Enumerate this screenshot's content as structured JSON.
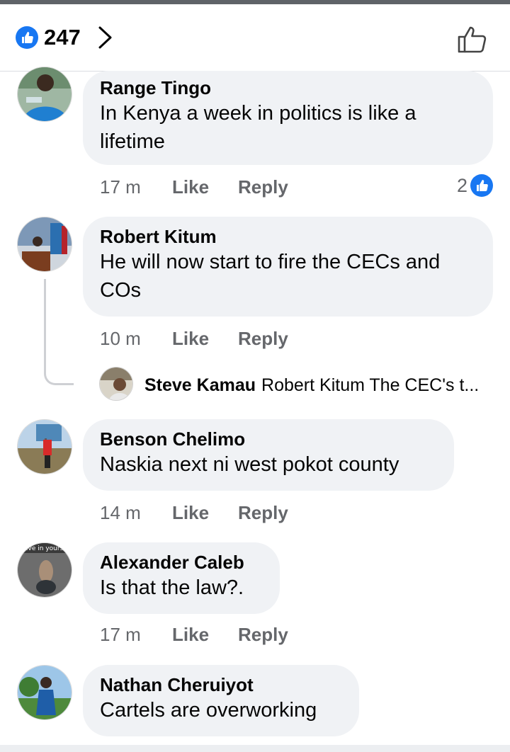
{
  "header": {
    "reaction_icon": "like-badge-icon",
    "reaction_count": "247",
    "chevron_icon": "chevron-right-icon",
    "like_button_icon": "thumbs-up-outline-icon"
  },
  "comments": [
    {
      "author": "Range Tingo",
      "text": "In Kenya a week in politics is like a lifetime",
      "time": "17 m",
      "like_label": "Like",
      "reply_label": "Reply",
      "reaction_count": "2"
    },
    {
      "author": "Robert Kitum",
      "text": "He will now start to fire the CECs and COs",
      "time": "10 m",
      "like_label": "Like",
      "reply_label": "Reply",
      "reply_preview": {
        "author": "Steve Kamau",
        "text": "Robert Kitum The CEC's t..."
      }
    },
    {
      "author": "Benson Chelimo",
      "text": "Naskia next ni west pokot county",
      "time": "14 m",
      "like_label": "Like",
      "reply_label": "Reply"
    },
    {
      "author": "Alexander Caleb",
      "text": "Is that the law?.",
      "time": "17 m",
      "like_label": "Like",
      "reply_label": "Reply",
      "avatar_caption": "lieve in yourse"
    },
    {
      "author": "Nathan Cheruiyot",
      "text": "Cartels are overworking"
    }
  ],
  "colors": {
    "facebook_blue": "#1877f2",
    "bubble_bg": "#f0f2f5",
    "meta_gray": "#65676b"
  }
}
